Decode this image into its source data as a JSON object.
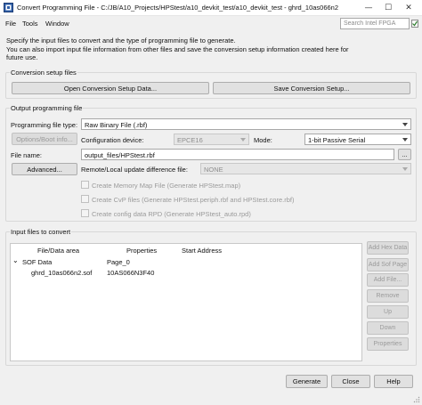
{
  "window": {
    "title": "Convert Programming File - C:/JB/A10_Projects/HPStest/a10_devkit_test/a10_devkit_test - ghrd_10as066n2",
    "minimize_glyph": "—",
    "maximize_glyph": "☐",
    "close_glyph": "✕"
  },
  "menu": {
    "items": [
      "File",
      "Tools",
      "Window"
    ]
  },
  "search": {
    "placeholder": "Search Intel FPGA"
  },
  "description": {
    "line1": "Specify the input files to convert and the type of programming file to generate.",
    "line2": "You can also import input file information from other files and save the conversion setup information created here for",
    "line3": "future use."
  },
  "conversion_setup": {
    "title": "Conversion setup files",
    "open_label": "Open Conversion Setup Data...",
    "save_label": "Save Conversion Setup..."
  },
  "output": {
    "title": "Output programming file",
    "file_type_label": "Programming file type:",
    "file_type_value": "Raw Binary File (.rbf)",
    "options_label": "Options/Boot info...",
    "config_device_label": "Configuration device:",
    "config_device_value": "EPCE16",
    "mode_label": "Mode:",
    "mode_value": "1-bit Passive Serial",
    "file_name_label": "File name:",
    "file_name_value": "output_files/HPStest.rbf",
    "browse_label": "...",
    "advanced_label": "Advanced...",
    "remote_local_label": "Remote/Local update difference file:",
    "remote_local_value": "NONE",
    "check_memory_map": "Create Memory Map File (Generate HPStest.map)",
    "check_cvp": "Create CvP files (Generate HPStest.periph.rbf and HPStest.core.rbf)",
    "check_rpd": "Create config data RPD (Generate HPStest_auto.rpd)"
  },
  "input": {
    "title": "Input files to convert",
    "columns": [
      "File/Data area",
      "Properties",
      "Start Address"
    ],
    "rows": [
      {
        "name": "SOF Data",
        "properties": "Page_0",
        "start": "",
        "expander": "⌄"
      },
      {
        "name": "ghrd_10as066n2.sof",
        "properties": "10AS066N3F40",
        "start": ""
      }
    ],
    "buttons": {
      "add_hex": "Add Hex Data",
      "add_sof": "Add Sof Page",
      "add_file": "Add File...",
      "remove": "Remove",
      "up": "Up",
      "down": "Down",
      "properties": "Properties"
    }
  },
  "footer": {
    "generate": "Generate",
    "close": "Close",
    "help": "Help"
  },
  "colors": {
    "window_bg": "#f0f0f0",
    "button_bg": "#e1e1e1",
    "disabled_text": "#9a9a9a",
    "icon_blue": "#3a6fb5"
  }
}
